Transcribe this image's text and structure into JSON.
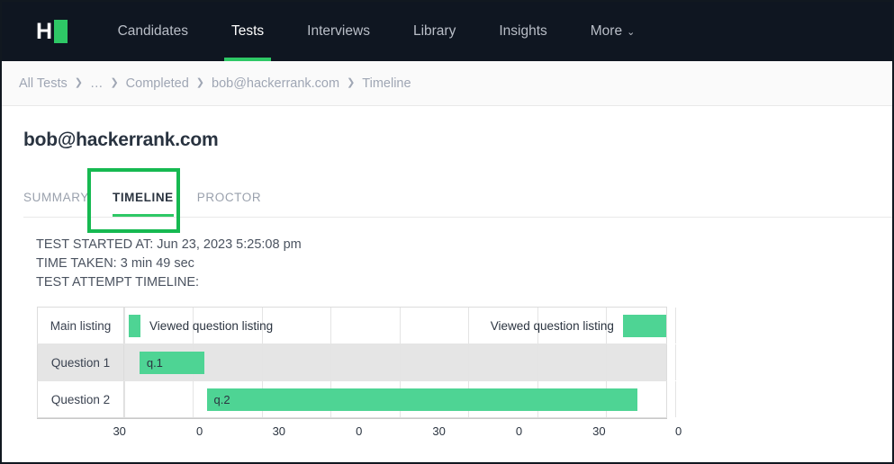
{
  "nav": {
    "logo_letter": "H",
    "items": [
      {
        "label": "Candidates",
        "active": false,
        "has_chevron": false
      },
      {
        "label": "Tests",
        "active": true,
        "has_chevron": false
      },
      {
        "label": "Interviews",
        "active": false,
        "has_chevron": false
      },
      {
        "label": "Library",
        "active": false,
        "has_chevron": false
      },
      {
        "label": "Insights",
        "active": false,
        "has_chevron": false
      },
      {
        "label": "More",
        "active": false,
        "has_chevron": true
      }
    ],
    "chevron_glyph": "⌄"
  },
  "breadcrumb": {
    "separator": "❯",
    "items": [
      "All Tests",
      "…",
      "Completed",
      "bob@hackerrank.com",
      "Timeline"
    ]
  },
  "page": {
    "title": "bob@hackerrank.com",
    "tabs": [
      {
        "label": "SUMMARY",
        "active": false
      },
      {
        "label": "TIMELINE",
        "active": true
      },
      {
        "label": "PROCTOR",
        "active": false
      }
    ]
  },
  "info": {
    "started_at": "TEST STARTED AT: Jun 23, 2023 5:25:08 pm",
    "time_taken": "TIME TAKEN: 3 min 49 sec",
    "attempt_timeline": "TEST ATTEMPT TIMELINE:"
  },
  "colors": {
    "nav_bg": "#0f1621",
    "accent_green": "#2ec866",
    "bar_green": "#4ed494",
    "annotation_green": "#16b951",
    "row_alt_bg": "#e5e5e5"
  },
  "chart_data": {
    "type": "bar",
    "title": "TEST ATTEMPT TIMELINE:",
    "orientation": "horizontal",
    "xlabel": "",
    "ylabel": "",
    "grid": true,
    "legend": "none",
    "categories": [
      "Main listing",
      "Question 1",
      "Question 2"
    ],
    "axis_ticks": [
      {
        "label": "30",
        "pct": 13.1
      },
      {
        "label": "0",
        "pct": 25.8
      },
      {
        "label": "30",
        "pct": 38.4
      },
      {
        "label": "0",
        "pct": 51.1
      },
      {
        "label": "30",
        "pct": 63.8
      },
      {
        "label": "0",
        "pct": 76.5
      },
      {
        "label": "30",
        "pct": 89.2
      },
      {
        "label": "0",
        "pct": 101.8
      }
    ],
    "gridlines_pct": [
      0,
      12.7,
      25.4,
      38.1,
      50.8,
      63.5,
      76.2,
      88.9,
      101.6
    ],
    "rows": [
      {
        "category": "Main listing",
        "alt_row": false,
        "bars": [
          {
            "label": "Viewed question listing",
            "label_position": "right",
            "start_pct": 0.9,
            "width_pct": 2.1
          },
          {
            "label": "Viewed question listing",
            "label_position": "left",
            "start_pct": 92.0,
            "width_pct": 8.0
          }
        ]
      },
      {
        "category": "Question 1",
        "alt_row": true,
        "bars": [
          {
            "label": "q.1",
            "label_position": "inside",
            "start_pct": 2.8,
            "width_pct": 12.0
          }
        ]
      },
      {
        "category": "Question 2",
        "alt_row": false,
        "bars": [
          {
            "label": "q.2",
            "label_position": "inside",
            "start_pct": 15.2,
            "width_pct": 79.5
          }
        ]
      }
    ]
  }
}
